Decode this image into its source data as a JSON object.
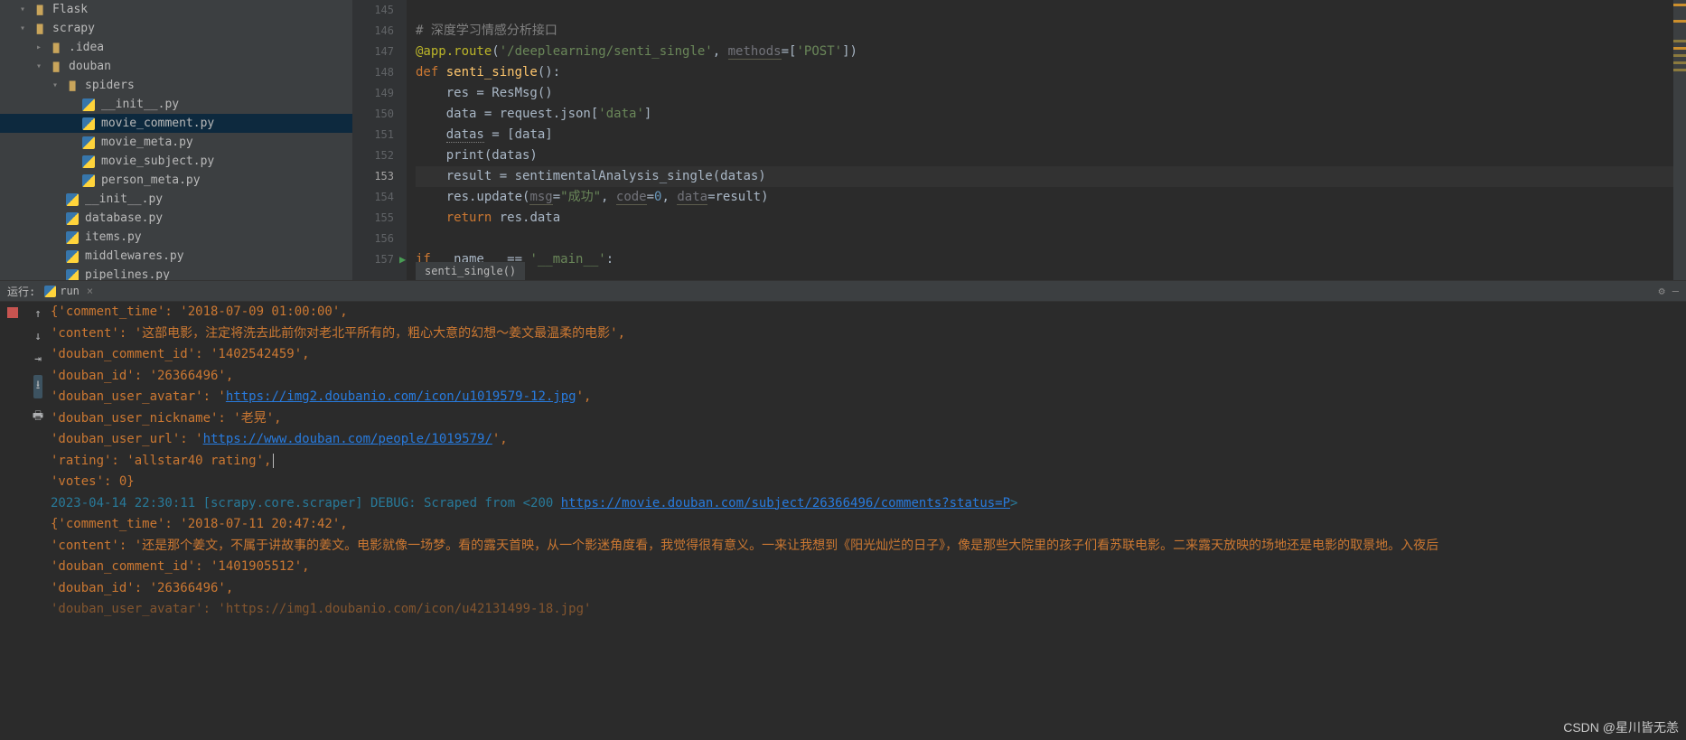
{
  "tree": {
    "items": [
      {
        "indent": 0,
        "toggle": "down",
        "icon": "folder",
        "label": "Flask"
      },
      {
        "indent": 0,
        "toggle": "down",
        "icon": "folder",
        "label": "scrapy"
      },
      {
        "indent": 1,
        "toggle": "right",
        "icon": "folder",
        "label": ".idea"
      },
      {
        "indent": 1,
        "toggle": "down",
        "icon": "folder",
        "label": "douban"
      },
      {
        "indent": 2,
        "toggle": "down",
        "icon": "folder",
        "label": "spiders"
      },
      {
        "indent": 3,
        "toggle": "none",
        "icon": "py",
        "label": "__init__.py"
      },
      {
        "indent": 3,
        "toggle": "none",
        "icon": "py",
        "label": "movie_comment.py",
        "selected": true
      },
      {
        "indent": 3,
        "toggle": "none",
        "icon": "py",
        "label": "movie_meta.py"
      },
      {
        "indent": 3,
        "toggle": "none",
        "icon": "py",
        "label": "movie_subject.py"
      },
      {
        "indent": 3,
        "toggle": "none",
        "icon": "py",
        "label": "person_meta.py"
      },
      {
        "indent": 2,
        "toggle": "none",
        "icon": "py",
        "label": "__init__.py"
      },
      {
        "indent": 2,
        "toggle": "none",
        "icon": "py",
        "label": "database.py"
      },
      {
        "indent": 2,
        "toggle": "none",
        "icon": "py",
        "label": "items.py"
      },
      {
        "indent": 2,
        "toggle": "none",
        "icon": "py",
        "label": "middlewares.py"
      },
      {
        "indent": 2,
        "toggle": "none",
        "icon": "py",
        "label": "pipelines.py"
      }
    ]
  },
  "editor": {
    "lines_start": 145,
    "lines_end": 157,
    "active_line": 153,
    "gutter_markers": {
      "157": "play"
    },
    "code": [
      "",
      "# 深度学习情感分析接口",
      "@app.route('/deeplearning/senti_single', methods=['POST'])",
      "def senti_single():",
      "    res = ResMsg()",
      "    data = request.json['data']",
      "    datas = [data]",
      "    print(datas)",
      "    result = sentimentalAnalysis_single(datas)",
      "    res.update(msg=\"成功\", code=0, data=result)",
      "    return res.data",
      "",
      "if __name__ == '__main__':"
    ],
    "breadcrumb": "senti_single()"
  },
  "run": {
    "panel_label": "运行:",
    "tab_name": "run",
    "output": [
      {
        "t": "dict",
        "text": "{'comment_time': '2018-07-09 01:00:00',"
      },
      {
        "t": "dict",
        "text": " 'content': '这部电影，注定将洗去此前你对老北平所有的，粗心大意的幻想～姜文最温柔的电影',"
      },
      {
        "t": "dict",
        "text": " 'douban_comment_id': '1402542459',"
      },
      {
        "t": "dict",
        "text": " 'douban_id': '26366496',"
      },
      {
        "t": "dict-link",
        "prefix": " 'douban_user_avatar': '",
        "link": "https://img2.doubanio.com/icon/u1019579-12.jpg",
        "suffix": "',"
      },
      {
        "t": "dict",
        "text": " 'douban_user_nickname': '老晃',"
      },
      {
        "t": "dict-link",
        "prefix": " 'douban_user_url': '",
        "link": "https://www.douban.com/people/1019579/",
        "suffix": "',"
      },
      {
        "t": "dict",
        "text": " 'rating': 'allstar40 rating',"
      },
      {
        "t": "dict",
        "text": " 'votes': 0}"
      },
      {
        "t": "log-link",
        "prefix": "2023-04-14 22:30:11 [scrapy.core.scraper] DEBUG: Scraped from <200 ",
        "link": "https://movie.douban.com/subject/26366496/comments?status=P",
        "suffix": ">"
      },
      {
        "t": "dict",
        "text": "{'comment_time': '2018-07-11 20:47:42',"
      },
      {
        "t": "dict",
        "text": " 'content': '还是那个姜文，不属于讲故事的姜文。电影就像一场梦。看的露天首映，从一个影迷角度看，我觉得很有意义。一来让我想到《阳光灿烂的日子》，像是那些大院里的孩子们看苏联电影。二来露天放映的场地还是电影的取景地。入夜后"
      },
      {
        "t": "dict",
        "text": " 'douban_comment_id': '1401905512',"
      },
      {
        "t": "dict",
        "text": " 'douban_id': '26366496',"
      },
      {
        "t": "dict-dim",
        "text": " 'douban_user_avatar': 'https://img1.doubanio.com/icon/u42131499-18.jpg'"
      }
    ]
  },
  "watermark": "CSDN @星川皆无恙"
}
